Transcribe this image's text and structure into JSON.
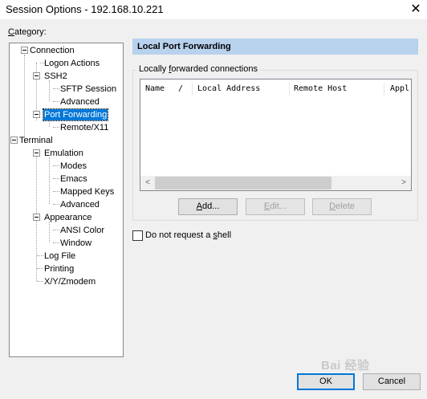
{
  "window": {
    "title": "Session Options - 192.168.10.221",
    "close_glyph": "✕"
  },
  "category": {
    "label_prefix": "",
    "label_accel": "C",
    "label_rest": "ategory:"
  },
  "tree": {
    "items": [
      {
        "label": "Connection",
        "level": 0,
        "expandable": true,
        "expanded": true
      },
      {
        "label": "Logon Actions",
        "level": 1
      },
      {
        "label": "SSH2",
        "level": 1,
        "expandable": true,
        "expanded": true
      },
      {
        "label": "SFTP Session",
        "level": 2
      },
      {
        "label": "Advanced",
        "level": 2
      },
      {
        "label": "Port Forwarding",
        "level": 1,
        "expandable": true,
        "expanded": true,
        "selected": true
      },
      {
        "label": "Remote/X11",
        "level": 2
      },
      {
        "label": "Terminal",
        "level": 0,
        "expandable": true,
        "expanded": true
      },
      {
        "label": "Emulation",
        "level": 1,
        "expandable": true,
        "expanded": true
      },
      {
        "label": "Modes",
        "level": 2
      },
      {
        "label": "Emacs",
        "level": 2
      },
      {
        "label": "Mapped Keys",
        "level": 2
      },
      {
        "label": "Advanced",
        "level": 2
      },
      {
        "label": "Appearance",
        "level": 1,
        "expandable": true,
        "expanded": true
      },
      {
        "label": "ANSI Color",
        "level": 2
      },
      {
        "label": "Window",
        "level": 2
      },
      {
        "label": "Log File",
        "level": 1
      },
      {
        "label": "Printing",
        "level": 1
      },
      {
        "label": "X/Y/Zmodem",
        "level": 1
      }
    ]
  },
  "panel": {
    "header": "Local Port Forwarding",
    "group_prefix": "Locally ",
    "group_accel": "f",
    "group_rest": "orwarded connections",
    "columns": [
      "Name",
      "/",
      "Local Address",
      "Remote Host",
      "Appl"
    ],
    "scroll_left_glyph": "<",
    "scroll_right_glyph": ">",
    "buttons": {
      "add": {
        "accel": "A",
        "rest": "dd...",
        "enabled": true
      },
      "edit": {
        "accel": "E",
        "rest": "dit...",
        "enabled": false
      },
      "delete": {
        "accel": "D",
        "rest": "elete",
        "enabled": false
      }
    },
    "checkbox": {
      "label_prefix": "Do not request a ",
      "label_accel": "s",
      "label_rest": "hell",
      "checked": false
    }
  },
  "footer": {
    "ok_label": "OK",
    "cancel_label": "Cancel",
    "watermark": "Bai 经验"
  }
}
